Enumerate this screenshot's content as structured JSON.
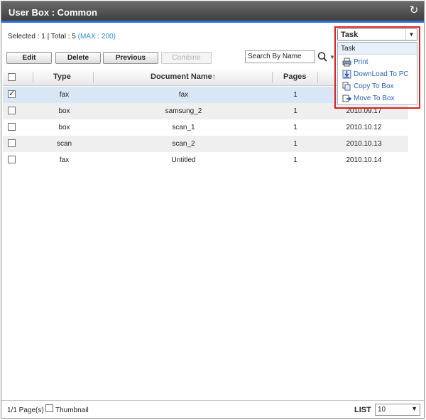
{
  "window": {
    "title": "User Box : Common"
  },
  "status": {
    "selected_text": "Selected : 1",
    "separator": "|",
    "total_text": "Total : 5",
    "max_text": "(MAX : 200)",
    "max_color": "#2d8fd5"
  },
  "toolbar": {
    "edit": "Edit",
    "delete": "Delete",
    "previous": "Previous",
    "combine": "Combine"
  },
  "search": {
    "value": "Search By Name",
    "icon": "magnifier"
  },
  "table": {
    "headers": {
      "type": "Type",
      "document_name": "Document Name",
      "sort_arrow": "↑",
      "pages": "Pages"
    },
    "rows": [
      {
        "checked": true,
        "type": "fax",
        "name": "fax",
        "pages": "1",
        "date": ""
      },
      {
        "checked": false,
        "type": "box",
        "name": "samsung_2",
        "pages": "1",
        "date": "2010.09.17"
      },
      {
        "checked": false,
        "type": "box",
        "name": "scan_1",
        "pages": "1",
        "date": "2010.10.12"
      },
      {
        "checked": false,
        "type": "scan",
        "name": "scan_2",
        "pages": "1",
        "date": "2010.10.13"
      },
      {
        "checked": false,
        "type": "fax",
        "name": "Untitled",
        "pages": "1",
        "date": "2010.10.14"
      }
    ]
  },
  "task": {
    "selected": "Task",
    "menu_header": "Task",
    "items": [
      {
        "label": "Print",
        "icon": "print-icon"
      },
      {
        "label": "DownLoad To PC",
        "icon": "download-icon"
      },
      {
        "label": "Copy To Box",
        "icon": "copy-icon"
      },
      {
        "label": "Move To Box",
        "icon": "move-icon"
      }
    ],
    "highlight_color": "#d9201f"
  },
  "footer": {
    "page_text": "1/1 Page(s)",
    "thumbnail_label": "Thumbnail",
    "list_label": "LIST",
    "list_value": "10"
  }
}
